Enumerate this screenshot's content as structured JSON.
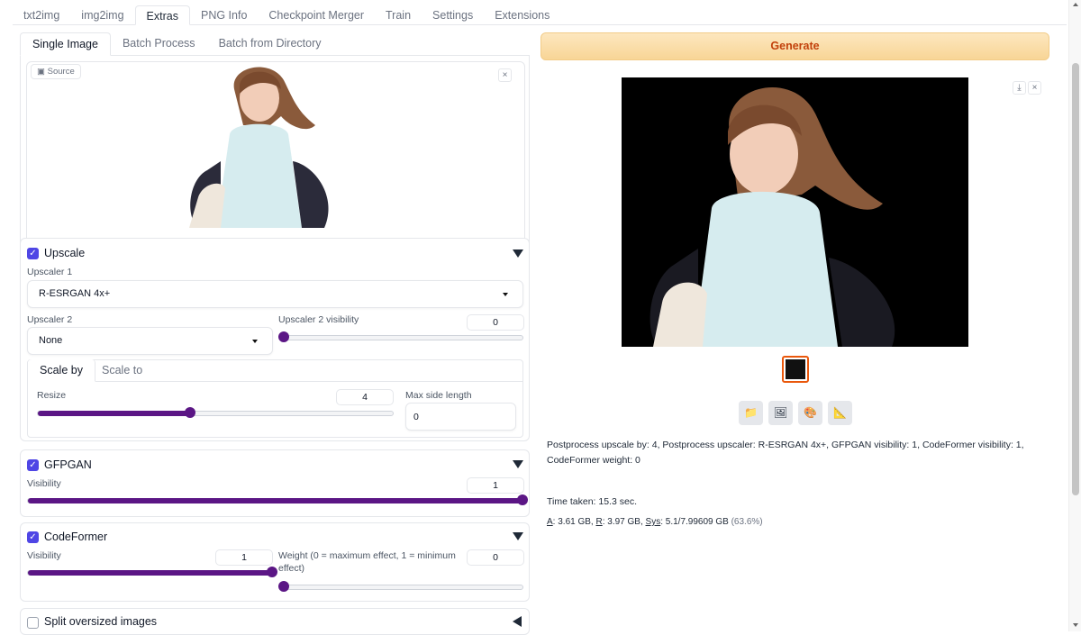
{
  "tabs": [
    "txt2img",
    "img2img",
    "Extras",
    "PNG Info",
    "Checkpoint Merger",
    "Train",
    "Settings",
    "Extensions"
  ],
  "subtabs": [
    "Single Image",
    "Batch Process",
    "Batch from Directory"
  ],
  "source": {
    "label": "Source",
    "close": "×"
  },
  "upscale": {
    "title": "Upscale",
    "checked": true,
    "upscaler1_label": "Upscaler 1",
    "upscaler1_value": "R-ESRGAN 4x+",
    "upscaler2_label": "Upscaler 2",
    "upscaler2_value": "None",
    "upscaler2_visibility_label": "Upscaler 2 visibility",
    "upscaler2_visibility_value": "0",
    "upscaler2_visibility_level": 0,
    "scale_tabs": [
      "Scale by",
      "Scale to"
    ],
    "resize_label": "Resize",
    "resize_value": "4",
    "resize_level": 0.43,
    "max_side_label": "Max side length",
    "max_side_value": "0"
  },
  "gfpgan": {
    "title": "GFPGAN",
    "checked": true,
    "visibility_label": "Visibility",
    "visibility_value": "1",
    "visibility_level": 1
  },
  "codeformer": {
    "title": "CodeFormer",
    "checked": true,
    "visibility_label": "Visibility",
    "visibility_value": "1",
    "visibility_level": 1,
    "weight_label": "Weight (0 = maximum effect, 1 = minimum effect)",
    "weight_value": "0",
    "weight_level": 0
  },
  "split": {
    "title": "Split oversized images",
    "checked": false
  },
  "generate_label": "Generate",
  "output": {
    "close": "×",
    "download": "⤓",
    "tools": [
      "folder-icon",
      "image-icon",
      "palette-icon",
      "ruler-icon"
    ]
  },
  "info": {
    "params": "Postprocess upscale by: 4, Postprocess upscaler: R-ESRGAN 4x+, GFPGAN visibility: 1, CodeFormer visibility: 1, CodeFormer weight: 0",
    "time": "Time taken: 15.3 sec.",
    "mem_a_label": "A",
    "mem_a_value": ": 3.61 GB, ",
    "mem_r_label": "R",
    "mem_r_value": ": 3.97 GB, ",
    "mem_sys_label": "Sys",
    "mem_sys_value": ": 5.1/7.99609 GB ",
    "mem_pct": "(63.6%)"
  },
  "colors": {
    "accent": "#5b1685",
    "checkbox": "#4f46e5",
    "generate_text": "#c2410c",
    "generate_bg": "#fbdfa9"
  }
}
